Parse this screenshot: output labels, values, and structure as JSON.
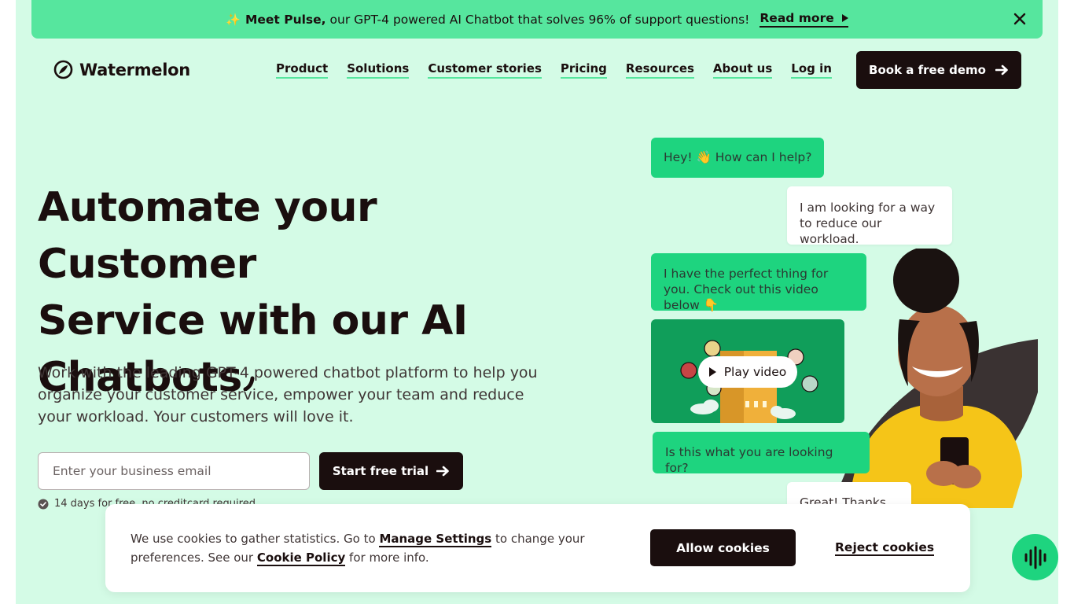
{
  "banner": {
    "emoji": "✨",
    "bold": "Meet Pulse,",
    "text": "our GPT-4 powered AI Chatbot that solves 96% of support questions!",
    "link": "Read more"
  },
  "nav": {
    "logo": "Watermelon",
    "items": [
      "Product",
      "Solutions",
      "Customer stories",
      "Pricing",
      "Resources",
      "About us",
      "Log in"
    ],
    "cta": "Book a free demo"
  },
  "hero": {
    "title_line1": "Automate your Customer",
    "title_line2": "Service with our AI",
    "title_line3": "Chatbots",
    "subtitle": "Work with the leading GPT-4 powered chatbot platform to help you organize your customer service, empower your team and reduce your workload. Your customers will love it.",
    "email_placeholder": "Enter your business email",
    "trial_button": "Start free trial",
    "note": "14 days for free, no creditcard required"
  },
  "chat": {
    "msg1": "Hey! 👋 How can I help?",
    "msg2": "I am looking for a way to reduce our workload.",
    "msg3": "I have the perfect thing for you. Check out this video below 👇",
    "video_label": "Play video",
    "msg4": "Is this what you are looking for?",
    "msg5": "Great! Thanks 😍"
  },
  "cookie": {
    "text_a": "We use cookies to gather statistics. Go to",
    "link_settings": "Manage Settings",
    "text_b": "to change your preferences. See our",
    "link_policy": "Cookie Policy",
    "text_c": "for more info.",
    "allow": "Allow cookies",
    "reject": "Reject cookies"
  },
  "colors": {
    "page_bg": "#d4fbe6",
    "banner_bg": "#56e69e",
    "accent_green": "#1ed47f",
    "dark": "#1a0e0e",
    "sweater_yellow": "#f5c518"
  }
}
